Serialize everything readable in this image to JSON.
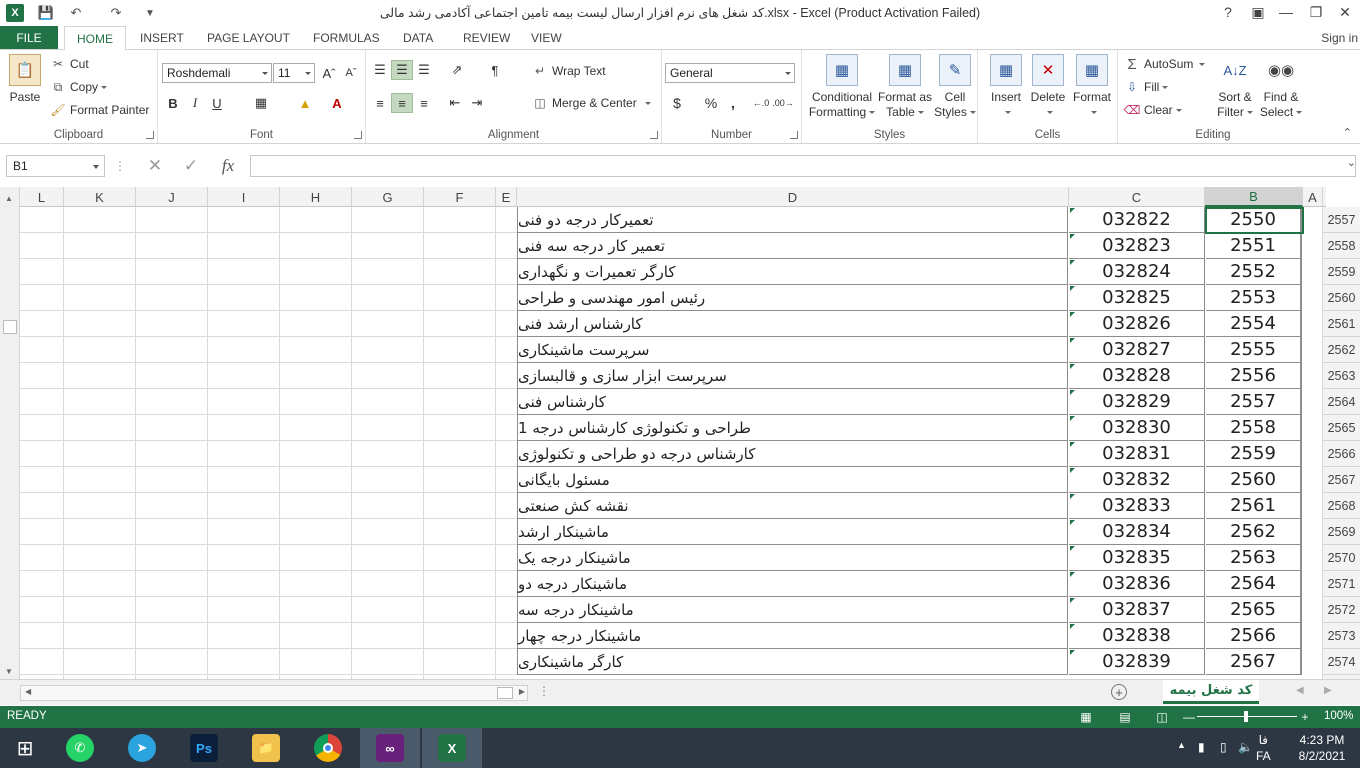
{
  "titlebar": {
    "title": "کد شغل های نرم افزار ارسال لیست بیمه تامین اجتماعی آکادمی رشد مالی.xlsx - Excel (Product Activation Failed)",
    "logo_text": "X"
  },
  "tabs": {
    "file": "FILE",
    "items": [
      "HOME",
      "INSERT",
      "PAGE LAYOUT",
      "FORMULAS",
      "DATA",
      "REVIEW",
      "VIEW"
    ],
    "signin": "Sign in"
  },
  "ribbon": {
    "clipboard": {
      "label": "Clipboard",
      "paste": "Paste",
      "cut": "Cut",
      "copy": "Copy",
      "format_painter": "Format Painter"
    },
    "font": {
      "label": "Font",
      "name": "Roshdemali",
      "size": "11",
      "bold": "B",
      "italic": "I",
      "underline": "U"
    },
    "alignment": {
      "label": "Alignment",
      "wrap_text": "Wrap Text",
      "merge_center": "Merge & Center"
    },
    "number": {
      "label": "Number",
      "format": "General",
      "currency": "$",
      "percent": "%",
      "comma": ","
    },
    "styles": {
      "label": "Styles",
      "conditional": "Conditional",
      "conditional2": "Formatting",
      "format_as": "Format as",
      "format_as2": "Table",
      "cell": "Cell",
      "cell2": "Styles"
    },
    "cells": {
      "label": "Cells",
      "insert": "Insert",
      "delete": "Delete",
      "format": "Format"
    },
    "editing": {
      "label": "Editing",
      "autosum": "AutoSum",
      "fill": "Fill",
      "clear": "Clear",
      "sort": "Sort &",
      "sort2": "Filter",
      "find": "Find &",
      "find2": "Select"
    }
  },
  "formula_bar": {
    "name_box": "B1",
    "fx": "fx",
    "value": ""
  },
  "columns": [
    "L",
    "K",
    "J",
    "I",
    "H",
    "G",
    "F",
    "E",
    "D",
    "C",
    "B",
    "A"
  ],
  "rows": [
    {
      "num": "2557",
      "b": "2550",
      "c": "032822",
      "d": "تعمیرکار درجه دو فنی"
    },
    {
      "num": "2558",
      "b": "2551",
      "c": "032823",
      "d": "تعمیر کار درجه سه فنی"
    },
    {
      "num": "2559",
      "b": "2552",
      "c": "032824",
      "d": "کارگر تعمیرات و نگهداری"
    },
    {
      "num": "2560",
      "b": "2553",
      "c": "032825",
      "d": "رئیس امور مهندسی و طراحی"
    },
    {
      "num": "2561",
      "b": "2554",
      "c": "032826",
      "d": "کارشناس ارشد فنی"
    },
    {
      "num": "2562",
      "b": "2555",
      "c": "032827",
      "d": "سرپرست ماشینکاری"
    },
    {
      "num": "2563",
      "b": "2556",
      "c": "032828",
      "d": "سرپرست ابزار سازی و قالبسازی"
    },
    {
      "num": "2564",
      "b": "2557",
      "c": "032829",
      "d": "کارشناس فنی"
    },
    {
      "num": "2565",
      "b": "2558",
      "c": "032830",
      "d": "طراحی و تکنولوژی کارشناس درجه 1"
    },
    {
      "num": "2566",
      "b": "2559",
      "c": "032831",
      "d": "کارشناس درجه دو طراحی و تکنولوژی"
    },
    {
      "num": "2567",
      "b": "2560",
      "c": "032832",
      "d": "مسئول بایگانی"
    },
    {
      "num": "2568",
      "b": "2561",
      "c": "032833",
      "d": "نقشه کش صنعتی"
    },
    {
      "num": "2569",
      "b": "2562",
      "c": "032834",
      "d": "ماشینکار ارشد"
    },
    {
      "num": "2570",
      "b": "2563",
      "c": "032835",
      "d": "ماشینکار درجه یک"
    },
    {
      "num": "2571",
      "b": "2564",
      "c": "032836",
      "d": "ماشینکار درجه دو"
    },
    {
      "num": "2572",
      "b": "2565",
      "c": "032837",
      "d": "ماشینکار درجه سه"
    },
    {
      "num": "2573",
      "b": "2566",
      "c": "032838",
      "d": "ماشینکار درجه چهار"
    },
    {
      "num": "2574",
      "b": "2567",
      "c": "032839",
      "d": "کارگر ماشینکاری"
    }
  ],
  "sheet": {
    "tab_name": "کد شغل بیمه",
    "add": "+"
  },
  "status": {
    "ready": "READY",
    "zoom": "100%"
  },
  "taskbar": {
    "time": "4:23 PM",
    "date": "8/2/2021",
    "lang": "FA",
    "lang2": "فا",
    "ps": "Ps",
    "excel": "X"
  },
  "colors": {
    "excel_green": "#217346",
    "taskbar": "#2d3743"
  }
}
